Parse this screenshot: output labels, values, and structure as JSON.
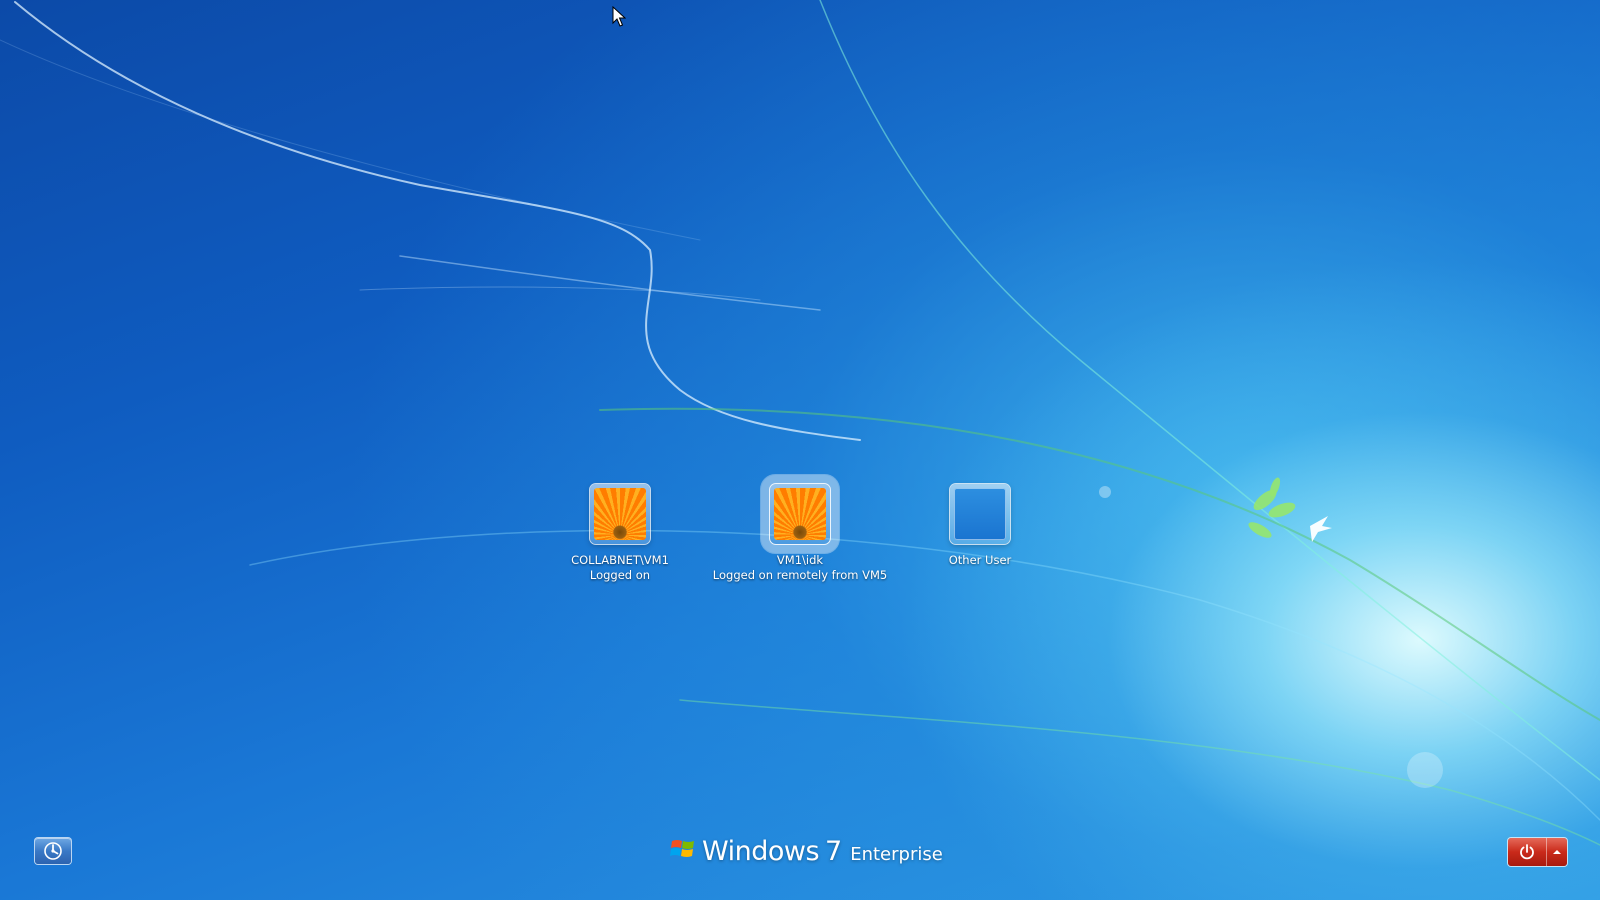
{
  "users": [
    {
      "name": "COLLABNET\\VM1",
      "status": "Logged on",
      "picture": "flower",
      "selected": false
    },
    {
      "name": "VM1\\idk",
      "status": "Logged on remotely from VM5",
      "picture": "flower",
      "selected": true
    },
    {
      "name": "Other User",
      "status": "",
      "picture": "empty",
      "selected": false
    }
  ],
  "branding": {
    "product": "Windows",
    "version": "7",
    "edition": "Enterprise",
    "logo_icon": "windows-flag-icon"
  },
  "controls": {
    "ease_of_access_icon": "ease-of-access-icon",
    "shutdown_icon": "power-icon",
    "shutdown_options_icon": "triangle-up-icon"
  },
  "colors": {
    "background_dark": "#0c4aa8",
    "background_light": "#2e9ae4",
    "shutdown_red": "#c92a1a",
    "text": "#ffffff"
  }
}
